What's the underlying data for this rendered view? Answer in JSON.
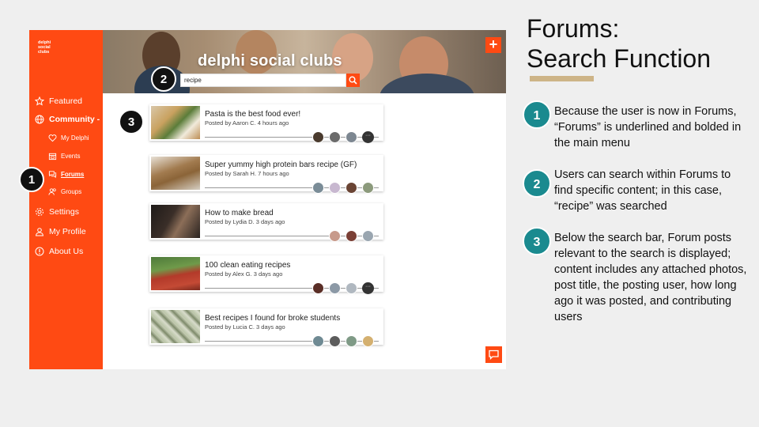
{
  "slide": {
    "title_line1": "Forums:",
    "title_line2": "Search Function",
    "accent_color": "#cdb487",
    "annotation_color": "#1a8a8f"
  },
  "annotations": [
    {
      "num": "1",
      "text": "Because the user is now in Forums, “Forums” is underlined and bolded in the main menu"
    },
    {
      "num": "2",
      "text": "Users can search within Forums to find specific content; in this case, “recipe” was searched"
    },
    {
      "num": "3",
      "text": "Below the search bar, Forum posts relevant to the search is displayed; content includes any attached photos, post title, the posting user, how long ago it was posted, and contributing users"
    }
  ],
  "app": {
    "brand_color": "#ff4a13",
    "logo_lines": [
      "delphi",
      "social",
      "clubs"
    ],
    "banner_title": "delphi social clubs",
    "add_button": "+",
    "search": {
      "value": "recipe",
      "icon": "search-icon"
    },
    "menu": {
      "featured": "Featured",
      "community": "Community -",
      "my_delphi": "My Delphi",
      "events": "Events",
      "forums": "Forums",
      "groups": "Groups",
      "settings": "Settings",
      "my_profile": "My Profile",
      "about_us": "About Us"
    },
    "posts": [
      {
        "title": "Pasta is the best food ever!",
        "meta": "Posted by Aaron C. 4 hours ago",
        "contributors": 4,
        "more": "···"
      },
      {
        "title": "Super yummy high protein bars recipe (GF)",
        "meta": "Posted by Sarah H. 7 hours ago",
        "contributors": 4
      },
      {
        "title": "How to make bread",
        "meta": "Posted by Lydia D. 3 days ago",
        "contributors": 3
      },
      {
        "title": "100 clean eating recipes",
        "meta": "Posted by Alex G. 3 days ago",
        "contributors": 4,
        "more": "···"
      },
      {
        "title": "Best recipes I found for broke students",
        "meta": "Posted by Lucia C. 3 days ago",
        "contributors": 4
      }
    ],
    "chat_icon": "chat-icon"
  },
  "markers": [
    "1",
    "2",
    "3"
  ]
}
